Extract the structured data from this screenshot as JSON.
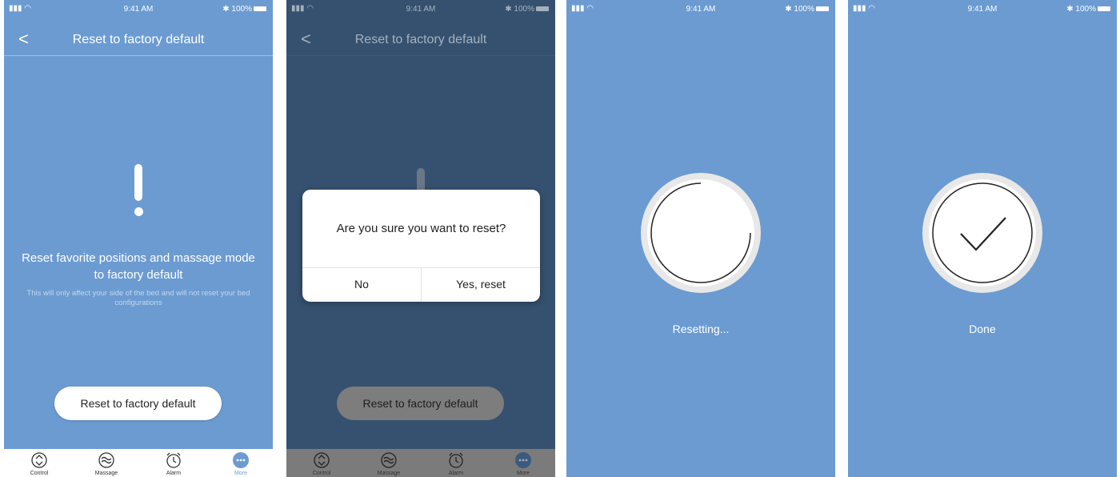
{
  "status_bar": {
    "time": "9:41 AM",
    "battery": "100%"
  },
  "screen1": {
    "nav_title": "Reset to factory default",
    "back_glyph": "<",
    "headline": "Reset favorite positions and massage mode to factory default",
    "subtext": "This will only affect your side of the bed and will not reset your bed configurations",
    "button_label": "Reset to factory default"
  },
  "screen2": {
    "nav_title": "Reset to factory default",
    "dialog_message": "Are you sure you want to reset?",
    "no_label": "No",
    "yes_label": "Yes, reset",
    "button_label": "Reset to factory default"
  },
  "screen3": {
    "state_text": "Resetting..."
  },
  "screen4": {
    "state_text": "Done"
  },
  "tabbar": {
    "items": [
      {
        "label": "Control",
        "icon": "control-icon"
      },
      {
        "label": "Massage",
        "icon": "massage-icon"
      },
      {
        "label": "Alarm",
        "icon": "alarm-icon"
      },
      {
        "label": "More",
        "icon": "more-icon"
      }
    ]
  },
  "colors": {
    "accent": "#6b9bd1",
    "dim_bg": "#35516f",
    "white": "#ffffff"
  }
}
